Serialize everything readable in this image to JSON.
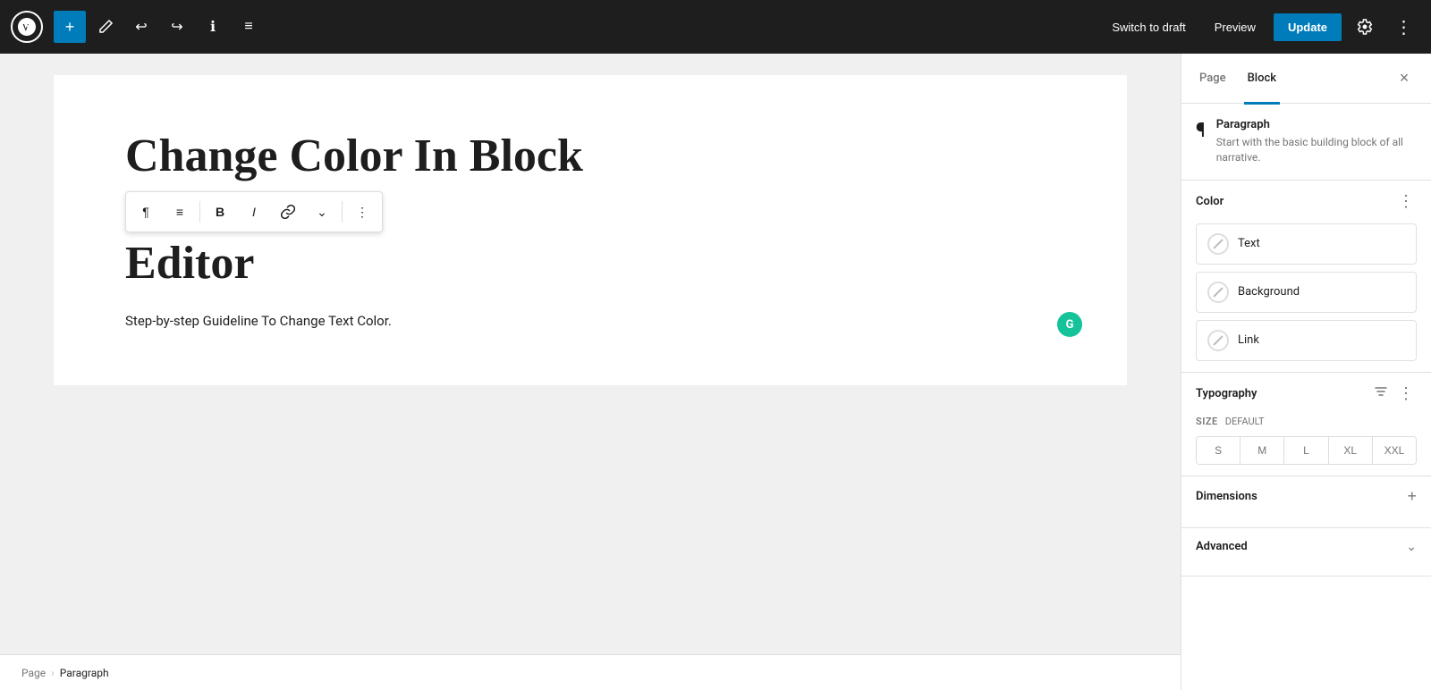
{
  "toolbar": {
    "add_label": "+",
    "undo_label": "↩",
    "redo_label": "↪",
    "info_label": "ℹ",
    "list_label": "≡",
    "switch_draft": "Switch to draft",
    "preview": "Preview",
    "update": "Update"
  },
  "editor": {
    "title_line1": "Change Color In Block",
    "title_line2": "Editor",
    "paragraph": "Step-by-step Guideline To Change Text Color."
  },
  "inline_toolbar": {
    "paragraph_icon": "¶",
    "align_icon": "≡",
    "bold_icon": "B",
    "italic_icon": "I",
    "link_icon": "⚭",
    "more_icon": "⌄",
    "dots_icon": "⋮"
  },
  "breadcrumb": {
    "page": "Page",
    "sep": "›",
    "paragraph": "Paragraph"
  },
  "sidebar": {
    "tab_page": "Page",
    "tab_block": "Block",
    "close_icon": "×",
    "block_info": {
      "icon": "¶",
      "name": "Paragraph",
      "description": "Start with the basic building block of all narrative."
    },
    "color": {
      "title": "Color",
      "more_icon": "⋮",
      "items": [
        {
          "label": "Text"
        },
        {
          "label": "Background"
        },
        {
          "label": "Link"
        }
      ]
    },
    "typography": {
      "title": "Typography",
      "more_icon": "⋮",
      "size_label": "SIZE",
      "size_default": "DEFAULT",
      "sizes": [
        "S",
        "M",
        "L",
        "XL",
        "XXL"
      ]
    },
    "dimensions": {
      "title": "Dimensions",
      "add_icon": "+"
    },
    "advanced": {
      "title": "Advanced",
      "toggle_icon": "⌄"
    }
  }
}
